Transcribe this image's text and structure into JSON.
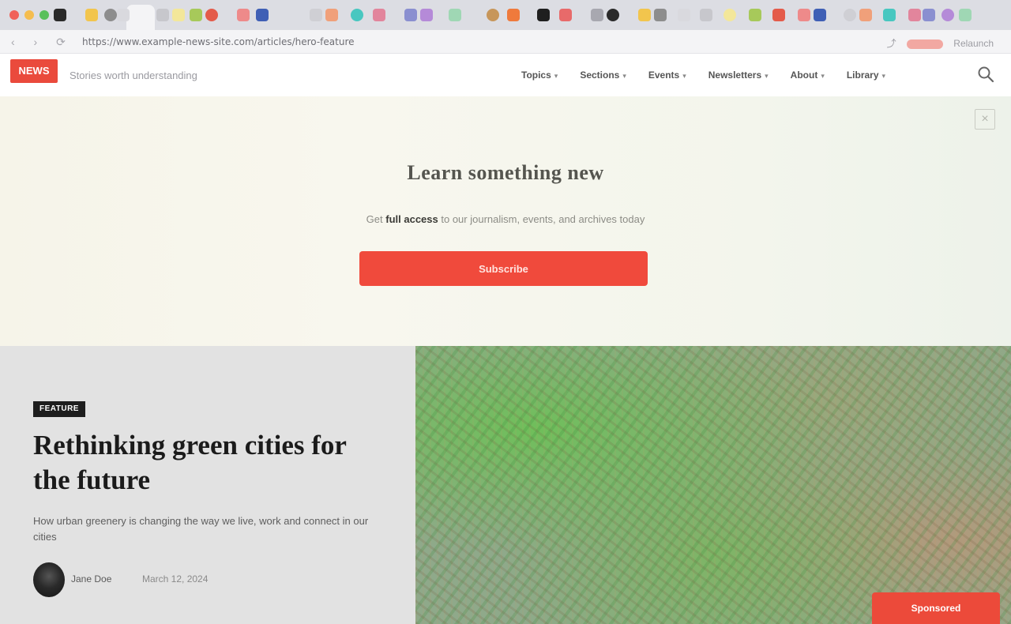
{
  "browser": {
    "url": "https://www.example-news-site.com/articles/hero-feature",
    "right_text": "Relaunch"
  },
  "site": {
    "logo_text": "NEWS",
    "tagline": "Stories worth understanding",
    "nav": [
      {
        "label": "Topics"
      },
      {
        "label": "Sections"
      },
      {
        "label": "Events"
      },
      {
        "label": "Newsletters"
      },
      {
        "label": "About"
      },
      {
        "label": "Library"
      }
    ]
  },
  "banner": {
    "headline": "Learn something new",
    "sub_prefix": "Get",
    "sub_bold": "full access",
    "sub_rest": "to our journalism, events, and archives today",
    "cta_label": "Subscribe",
    "close_glyph": "×"
  },
  "article": {
    "category": "Feature",
    "title": "Rethinking green cities for the future",
    "subtitle": "How urban greenery is changing the way we live, work and connect in our cities",
    "author": "Jane Doe",
    "date": "March 12, 2024"
  },
  "image_tag": "Sponsored",
  "colors": {
    "accent": "#f04a3c",
    "banner_bg": "#f6f4e9",
    "hero_left_bg": "#e2e2e2"
  }
}
